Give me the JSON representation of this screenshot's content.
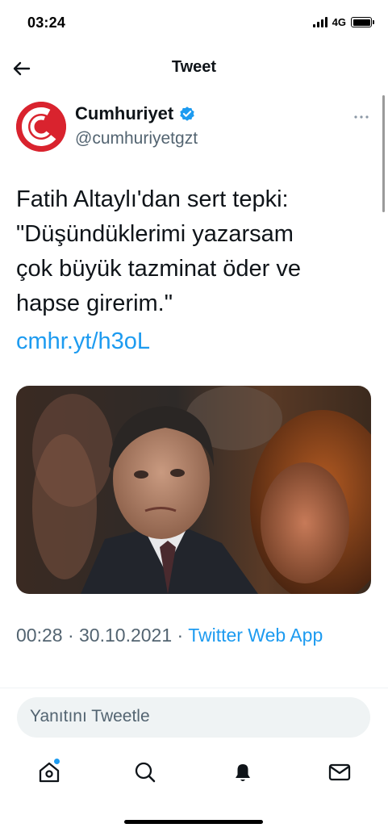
{
  "status_bar": {
    "time": "03:24",
    "network": "4G"
  },
  "header": {
    "title": "Tweet",
    "back_icon": "arrow-left-icon"
  },
  "tweet": {
    "author_name": "Cumhuriyet",
    "author_handle": "@cumhuriyetgzt",
    "verified_icon": "verified-badge-icon",
    "more_icon": "more-horizontal-icon",
    "text": "Fatih Altaylı'dan sert tepki:\n\"Düşündüklerimi yazarsam\nçok büyük tazminat öder ve\nhapse girerim.\"",
    "link": "cmhr.yt/h3oL",
    "time": "00:28",
    "date": "30.10.2021",
    "separator": "·",
    "source": "Twitter Web App"
  },
  "reply": {
    "placeholder": "Yanıtını Tweetle"
  },
  "tab_bar": {
    "items": [
      {
        "icon": "home-icon"
      },
      {
        "icon": "search-icon"
      },
      {
        "icon": "notifications-bell-icon"
      },
      {
        "icon": "messages-envelope-icon"
      }
    ]
  },
  "colors": {
    "accent": "#1d9bf0",
    "text": "#0f1419",
    "secondary_text": "#536471",
    "brand_red": "#d9232e"
  }
}
